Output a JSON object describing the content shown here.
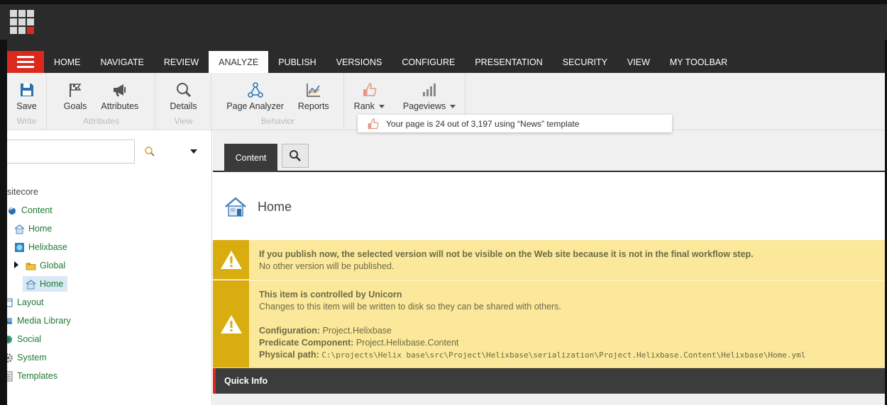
{
  "tabs": [
    "HOME",
    "NAVIGATE",
    "REVIEW",
    "ANALYZE",
    "PUBLISH",
    "VERSIONS",
    "CONFIGURE",
    "PRESENTATION",
    "SECURITY",
    "VIEW",
    "MY TOOLBAR"
  ],
  "active_tab": "ANALYZE",
  "ribbon": {
    "write": {
      "group": "Write",
      "save": "Save"
    },
    "attributes": {
      "group": "Attributes",
      "goals": "Goals",
      "attributes": "Attributes"
    },
    "view": {
      "group": "View",
      "details": "Details"
    },
    "behavior": {
      "group": "Behavior",
      "page_analyzer": "Page Analyzer",
      "reports": "Reports"
    },
    "rank": "Rank",
    "pageviews": "Pageviews"
  },
  "rank_popup": "Your page is 24 out of 3,197 using “News” template",
  "tree": {
    "root": "sitecore",
    "content": "Content",
    "home": "Home",
    "helixbase": "Helixbase",
    "global": "Global",
    "home_selected": "Home",
    "layout": "Layout",
    "media_library": "Media Library",
    "social": "Social",
    "system": "System",
    "templates": "Templates"
  },
  "editor": {
    "content_tab": "Content",
    "item_title": "Home",
    "warning1": {
      "title": "If you publish now, the selected version will not be visible on the Web site because it is not in the final workflow step.",
      "sub": "No other version will be published."
    },
    "warning2": {
      "title": "This item is controlled by Unicorn",
      "sub": "Changes to this item will be written to disk so they can be shared with others.",
      "config_label": "Configuration:",
      "config_value": "Project.Helixbase",
      "predicate_label": "Predicate Component:",
      "predicate_value": "Project.Helixbase.Content",
      "path_label": "Physical path:",
      "path_value": "C:\\projects\\Helix base\\src\\Project\\Helixbase\\serialization\\Project.Helixbase.Content\\Helixbase\\Home.yml"
    },
    "quick_info": "Quick Info"
  },
  "colors": {
    "brand_red": "#dc291e",
    "dark": "#2b2b2b",
    "warning_bg": "#fbe89a",
    "warning_side": "#d9ac0f",
    "tree_green": "#1e7a32"
  }
}
